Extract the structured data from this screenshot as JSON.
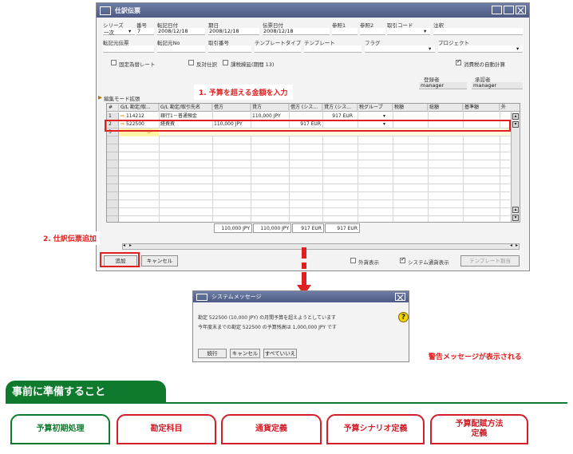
{
  "window": {
    "title": "仕訳伝票",
    "labels": {
      "series": "シリーズ",
      "number": "番号",
      "posting_date": "転記日付",
      "due_date": "期日",
      "doc_date": "伝票日付",
      "ref1": "参照1",
      "ref2": "参照2",
      "trans_code": "取引コード",
      "remarks": "注釈",
      "origin_doc": "転記元伝票",
      "origin_no": "転記元No",
      "trans_no": "取引番号",
      "template_type": "テンプレートタイプ",
      "template": "テンプレート",
      "flag": "フラグ",
      "project": "プロジェクト"
    },
    "values": {
      "series": "一次",
      "number": "7",
      "posting_date": "2008/12/18",
      "due_date": "2008/12/18",
      "doc_date": "2008/12/18"
    },
    "checkboxes": {
      "fixed_rate": "固定為替レート",
      "reverse": "反対仕訳",
      "auto_tax": "課税繰延(期間 13)",
      "vat_auto": "消費税の自動計算"
    },
    "creator_label": "登録者",
    "approver_label": "承認者",
    "creator": "manager",
    "approver": "manager",
    "edit_mode": "編集モード拡張",
    "columns": [
      "#",
      "G/L 勘定/取...",
      "G/L 勘定/取引先名",
      "借方",
      "貸方",
      "借方 (シス...",
      "貸方 (シス...",
      "税グループ",
      "税額",
      "総額",
      "基準額",
      "外"
    ],
    "rows": [
      {
        "no": "1",
        "account": "114212",
        "name": "銀行1－普通預金",
        "debit": "",
        "credit": "110,000 JPY",
        "sys_debit": "",
        "sys_credit": "917 EUR"
      },
      {
        "no": "2",
        "account": "522500",
        "name": "経費費",
        "debit": "110,000 JPY",
        "credit": "",
        "sys_debit": "917 EUR",
        "sys_credit": ""
      },
      {
        "no": "3",
        "account": "",
        "name": "",
        "debit": "",
        "credit": "",
        "sys_debit": "",
        "sys_credit": ""
      }
    ],
    "totals": {
      "debit": "110,000 JPY",
      "credit": "110,000 JPY",
      "sys_debit": "917 EUR",
      "sys_credit": "917 EUR"
    },
    "buttons": {
      "add": "追加",
      "cancel": "キャンセル",
      "foreign": "外貨表示",
      "system_currency": "システム通貨表示",
      "template_btn": "テンプレート割当"
    }
  },
  "callouts": {
    "step1": "1. 予算を超える金額を入力",
    "step2": "2. 仕訳伝票追加",
    "warning": "警告メッセージが表示される"
  },
  "dialog": {
    "title": "システムメッセージ",
    "line1": "勘定 522500 (10,000 JPY) の月間予算を超えようとしています",
    "line2": "今年度末までの勘定 522500 の予算残高は 1,000,000 JPY です",
    "buttons": {
      "run": "続行",
      "cancel": "キャンセル",
      "all_no": "すべていいえ"
    }
  },
  "section_title": "事前に準備すること",
  "topics": [
    "予算初期処理",
    "勘定科目",
    "通貨定義",
    "予算シナリオ定義",
    "予算配賦方法\n定義"
  ],
  "colors": {
    "green": "#0f7a2e",
    "red": "#d21f2a",
    "title_bar": "#5a6890"
  }
}
